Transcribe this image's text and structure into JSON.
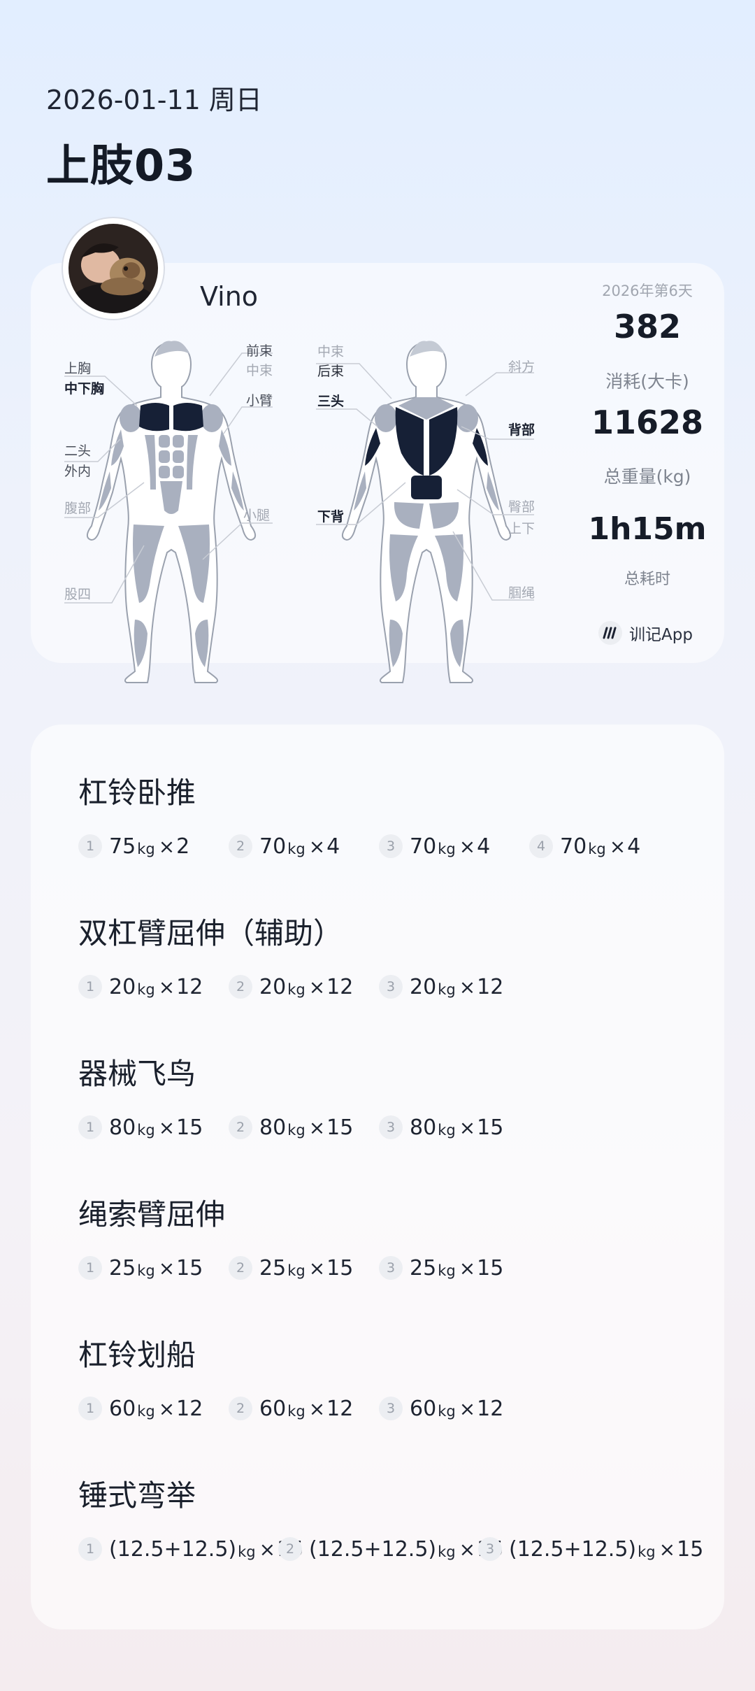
{
  "header": {
    "date": "2026-01-11 周日",
    "title": "上肢03"
  },
  "profile": {
    "name": "Vino"
  },
  "muscle_labels": {
    "front_left": [
      {
        "text": "上胸",
        "active": false
      },
      {
        "text": "中下胸",
        "active": true
      },
      {
        "text": "二头",
        "active": false
      },
      {
        "text": "外内",
        "active": false
      },
      {
        "text": "腹部",
        "active": false
      },
      {
        "text": "股四",
        "active": false
      }
    ],
    "front_right": [
      {
        "text": "前束",
        "active": false
      },
      {
        "text": "中束",
        "active": false
      },
      {
        "text": "小臂",
        "active": false
      },
      {
        "text": "小腿",
        "active": false
      }
    ],
    "back_left": [
      {
        "text": "中束",
        "active": false
      },
      {
        "text": "后束",
        "active": false
      },
      {
        "text": "三头",
        "active": true
      },
      {
        "text": "下背",
        "active": true
      }
    ],
    "back_right": [
      {
        "text": "斜方",
        "active": false
      },
      {
        "text": "背部",
        "active": true
      },
      {
        "text": "臀部",
        "active": false
      },
      {
        "text": "上下",
        "active": false
      },
      {
        "text": "腘绳",
        "active": false
      }
    ]
  },
  "stats": {
    "week": "2026年第6天",
    "calories": "382",
    "calories_label": "消耗(大卡)",
    "volume": "11628",
    "volume_label": "总重量(kg)",
    "duration": "1h15m",
    "duration_label": "总耗时"
  },
  "brand": {
    "name": "训记App"
  },
  "exercises": [
    {
      "name": "杠铃卧推",
      "sets": [
        {
          "num": "1",
          "w": "75",
          "u": "kg",
          "x": "×",
          "r": "2"
        },
        {
          "num": "2",
          "w": "70",
          "u": "kg",
          "x": "×",
          "r": "4"
        },
        {
          "num": "3",
          "w": "70",
          "u": "kg",
          "x": "×",
          "r": "4"
        },
        {
          "num": "4",
          "w": "70",
          "u": "kg",
          "x": "×",
          "r": "4"
        }
      ]
    },
    {
      "name": "双杠臂屈伸（辅助）",
      "sets": [
        {
          "num": "1",
          "w": "20",
          "u": "kg",
          "x": "×",
          "r": "12"
        },
        {
          "num": "2",
          "w": "20",
          "u": "kg",
          "x": "×",
          "r": "12"
        },
        {
          "num": "3",
          "w": "20",
          "u": "kg",
          "x": "×",
          "r": "12"
        }
      ]
    },
    {
      "name": "器械飞鸟",
      "sets": [
        {
          "num": "1",
          "w": "80",
          "u": "kg",
          "x": "×",
          "r": "15"
        },
        {
          "num": "2",
          "w": "80",
          "u": "kg",
          "x": "×",
          "r": "15"
        },
        {
          "num": "3",
          "w": "80",
          "u": "kg",
          "x": "×",
          "r": "15"
        }
      ]
    },
    {
      "name": "绳索臂屈伸",
      "sets": [
        {
          "num": "1",
          "w": "25",
          "u": "kg",
          "x": "×",
          "r": "15"
        },
        {
          "num": "2",
          "w": "25",
          "u": "kg",
          "x": "×",
          "r": "15"
        },
        {
          "num": "3",
          "w": "25",
          "u": "kg",
          "x": "×",
          "r": "15"
        }
      ]
    },
    {
      "name": "杠铃划船",
      "sets": [
        {
          "num": "1",
          "w": "60",
          "u": "kg",
          "x": "×",
          "r": "12"
        },
        {
          "num": "2",
          "w": "60",
          "u": "kg",
          "x": "×",
          "r": "12"
        },
        {
          "num": "3",
          "w": "60",
          "u": "kg",
          "x": "×",
          "r": "12"
        }
      ]
    },
    {
      "name": "锤式弯举",
      "sets": [
        {
          "num": "1",
          "w": "(12.5+12.5)",
          "u": "kg",
          "x": "×",
          "r": "15"
        },
        {
          "num": "2",
          "w": "(12.5+12.5)",
          "u": "kg",
          "x": "×",
          "r": "15"
        },
        {
          "num": "3",
          "w": "(12.5+12.5)",
          "u": "kg",
          "x": "×",
          "r": "15"
        }
      ]
    }
  ],
  "colors": {
    "active_muscle": "#162036",
    "inactive_muscle": "#a9b0bf",
    "text_dark": "#1c2230"
  }
}
